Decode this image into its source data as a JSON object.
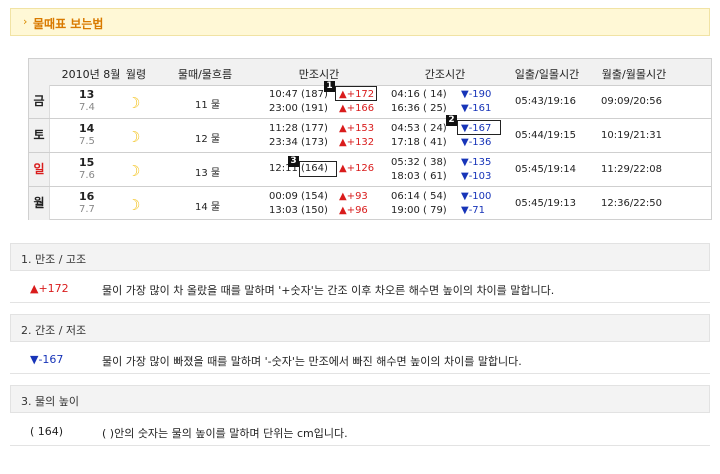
{
  "header": {
    "arrow": "›",
    "title": "물때표 보는법"
  },
  "table": {
    "headers": {
      "date_month": "2010년 8월",
      "moon_phase": "월령",
      "tide": "물때/물흐름",
      "high": "만조시간",
      "low": "간조시간",
      "sun": "일출/일몰시간",
      "moonrise": "월출/월몰시간"
    },
    "rows": [
      {
        "day": "금",
        "day_color": "#222222",
        "date": "13",
        "lunar": "7.4",
        "tide": "11 물",
        "high1": "10:47 (187)",
        "high1_diff": "▲+172",
        "high2": "23:00 (191)",
        "high2_diff": "▲+166",
        "low1": "04:16 ( 14)",
        "low1_diff": "▼-190",
        "low2": "16:36 ( 25)",
        "low2_diff": "▼-161",
        "sun": "05:43/19:16",
        "moon": "09:09/20:56"
      },
      {
        "day": "토",
        "day_color": "#222222",
        "date": "14",
        "lunar": "7.5",
        "tide": "12 물",
        "high1": "11:28 (177)",
        "high1_diff": "▲+153",
        "high2": "23:34 (173)",
        "high2_diff": "▲+132",
        "low1": "04:53 ( 24)",
        "low1_diff": "▼-167",
        "low2": "17:18 ( 41)",
        "low2_diff": "▼-136",
        "sun": "05:44/19:15",
        "moon": "10:19/21:31"
      },
      {
        "day": "일",
        "day_color": "#d91c1c",
        "date": "15",
        "lunar": "7.6",
        "tide": "13 물",
        "high1": "12:11 (164)",
        "high1_diff": "▲+126",
        "high2": "",
        "high2_diff": "",
        "low1": "05:32 ( 38)",
        "low1_diff": "▼-135",
        "low2": "18:03 ( 61)",
        "low2_diff": "▼-103",
        "sun": "05:45/19:14",
        "moon": "11:29/22:08"
      },
      {
        "day": "월",
        "day_color": "#222222",
        "date": "16",
        "lunar": "7.7",
        "tide": "14 물",
        "high1": "00:09 (154)",
        "high1_diff": "▲+93",
        "high2": "13:03 (150)",
        "high2_diff": "▲+96",
        "low1": "06:14 ( 54)",
        "low1_diff": "▼-100",
        "low2": "19:00 ( 79)",
        "low2_diff": "▼-71",
        "sun": "05:45/19:13",
        "moon": "12:36/22:50"
      }
    ],
    "markers": [
      "1",
      "2",
      "3"
    ]
  },
  "notes": [
    {
      "title": "1. 만조 / 고조",
      "key": "▲+172",
      "key_color": "#d91c1c",
      "text": "물이 가장 많이 차 올랐을 때를 말하며 '+숫자'는 간조 이후 차오른 해수면 높이의 차이를 말합니다."
    },
    {
      "title": "2. 간조 / 저조",
      "key": "▼-167",
      "key_color": "#1734b8",
      "text": "물이 가장 많이 빠졌을 때를 말하며 '-숫자'는 만조에서 빠진 해수면 높이의 차이를 말합니다."
    },
    {
      "title": "3. 물의 높이",
      "key": "( 164)",
      "key_color": "#222222",
      "text": "( )안의 숫자는 물의 높이를 말하며 단위는 cm입니다."
    }
  ],
  "colors": {
    "up": "#d91c1c",
    "down": "#1734b8",
    "moon": "#f3c21b",
    "accent": "#d97a00"
  },
  "icons": {
    "moon": "crescent-moon-icon"
  }
}
